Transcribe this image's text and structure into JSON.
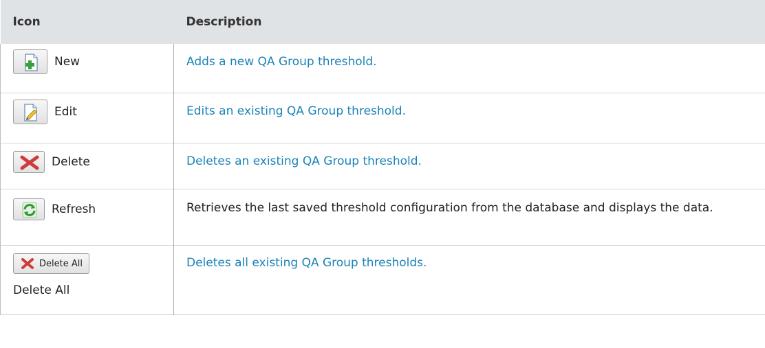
{
  "table": {
    "headers": [
      "Icon",
      "Description"
    ],
    "rows": [
      {
        "icon": "new-icon",
        "label": "New",
        "description": "Adds a new QA Group threshold."
      },
      {
        "icon": "edit-icon",
        "label": "Edit",
        "description": "Edits an existing QA Group threshold."
      },
      {
        "icon": "delete-icon",
        "label": "Delete",
        "description": "Deletes an existing QA Group threshold."
      },
      {
        "icon": "refresh-icon",
        "label": "Refresh",
        "description": "Retrieves the last saved threshold configuration from the database and displays the data."
      },
      {
        "icon": "delete-all-icon",
        "label": "Delete All",
        "button_text": "Delete All",
        "description": "Deletes all existing QA Group thresholds."
      }
    ]
  },
  "colors": {
    "header_bg": "#dfe3e6",
    "link_text": "#1a83b8",
    "body_text": "#222222"
  }
}
